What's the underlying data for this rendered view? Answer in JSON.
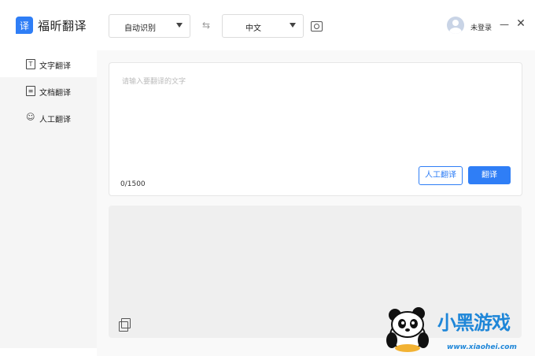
{
  "app": {
    "logo_glyph": "译",
    "title": "福昕翻译",
    "brand_color": "#2f7ef6"
  },
  "toolbar": {
    "source_language": "自动识别",
    "swap_icon": "⇆",
    "target_language": "中文",
    "camera_icon": "camera-icon"
  },
  "user": {
    "login_label": "未登录"
  },
  "window": {
    "minimize_glyph": "—",
    "close_glyph": "✕"
  },
  "sidebar": {
    "items": [
      {
        "label": "文字翻译",
        "icon": "text-icon",
        "icon_glyph": "T",
        "active": true
      },
      {
        "label": "文档翻译",
        "icon": "document-icon",
        "icon_glyph": "≡",
        "active": false
      },
      {
        "label": "人工翻译",
        "icon": "human-icon",
        "icon_glyph": "☺",
        "active": false
      }
    ]
  },
  "input": {
    "placeholder": "请输入要翻译的文字",
    "counter": "0/1500",
    "human_button": "人工翻译",
    "translate_button": "翻译"
  },
  "output": {
    "copy_icon": "copy-icon"
  },
  "watermark": {
    "text": "小黑游戏",
    "url": "www.xiaohei.com"
  }
}
